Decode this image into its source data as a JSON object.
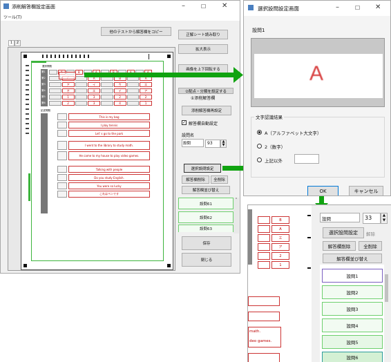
{
  "main_window": {
    "title": "添削解答欄設定画面",
    "menu": "ツール(T)",
    "tabs": [
      "1",
      "2"
    ],
    "btn_copy_from_other_test": "他のテストから解答欄をコピー",
    "btn_read_answer_sheet": "正解シート読み取り",
    "btn_zoom": "拡大表示",
    "btn_rotate": "画像を上下回転する",
    "btn_set_points": "②配点・分類を設定する",
    "section_title": "①添削解答欄",
    "btn_reset_answer": "添削解答欄再設定",
    "auto_set_label": "解答欄自動設定",
    "question_name_label": "設問名",
    "question_name_value": "設問",
    "question_number": "93",
    "btn_select_question": "選択設問設定",
    "btn_release": "解除",
    "btn_delete_answer": "解答欄削除",
    "btn_delete_all": "全削除",
    "btn_sort": "解答欄並び替え",
    "question_items": [
      "設問61",
      "設問62",
      "設問63"
    ],
    "btn_save": "保存",
    "btn_close": "閉じる"
  },
  "paper": {
    "header_label": "選択問題",
    "rows": [
      {
        "no": "第1",
        "cells": [
          "A",
          "B",
          "A",
          "B",
          "A",
          "A"
        ]
      },
      {
        "no": "第2",
        "cells": [
          "C",
          "A",
          "B",
          "A"
        ]
      },
      {
        "no": "第3",
        "cells": [
          "ア",
          "イ",
          "ウ",
          "エ"
        ]
      },
      {
        "no": "第4",
        "cells": [
          "オ",
          "エ",
          "イ",
          "ア"
        ]
      },
      {
        "no": "第5",
        "cells": [
          "1",
          "3",
          "2",
          "2"
        ]
      },
      {
        "no": "第6",
        "cells": [
          "2",
          "3",
          "4",
          "1"
        ]
      }
    ],
    "english_header": "記述問題",
    "english_lines": [
      "This is my bag",
      "I play tennis",
      "Let' s go to the park",
      "I went to the library to study math.",
      "He came to my house to play video games.",
      "Talking with people",
      "Do you study English.",
      "You were so lucky",
      "これはペンです"
    ]
  },
  "dialog": {
    "title": "選択設問設定画面",
    "question_label": "設問1",
    "preview_letter": "A",
    "group_title": "文字認識結果",
    "options": [
      "A（アルファベット大文字）",
      "2（数字）",
      "上記以外"
    ],
    "other_value": "",
    "btn_ok": "OK",
    "btn_cancel": "キャンセル"
  },
  "zoom_panel": {
    "question_name_value": "設問",
    "question_number": "33",
    "btn_select_question": "選択設問設定",
    "btn_release": "解除",
    "btn_delete_answer": "解答欄削除",
    "btn_delete_all": "全削除",
    "btn_sort": "解答欄並び替え",
    "question_items": [
      "設問1",
      "設問2",
      "設問3",
      "設問4",
      "設問5",
      "設問6"
    ],
    "cells": [
      "B",
      "A",
      "エ",
      "ア",
      "2",
      "1"
    ],
    "english_fragments": [
      "math.",
      "deo games."
    ]
  },
  "colors": {
    "accent_green": "#10a310",
    "answer_red": "#cc2222",
    "selected_purple": "#7a5fc0"
  }
}
